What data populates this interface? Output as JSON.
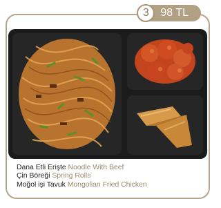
{
  "badge": {
    "quantity": "3",
    "price": "98 TL"
  },
  "dishes": [
    {
      "tr": "Dana Etli Erişte",
      "en": "Noodle With Beef"
    },
    {
      "tr": "Çin Böreği",
      "en": "Spring Rolls"
    },
    {
      "tr": "Moğol işi Tavuk",
      "en": "Mongolian Fried Chicken"
    }
  ]
}
